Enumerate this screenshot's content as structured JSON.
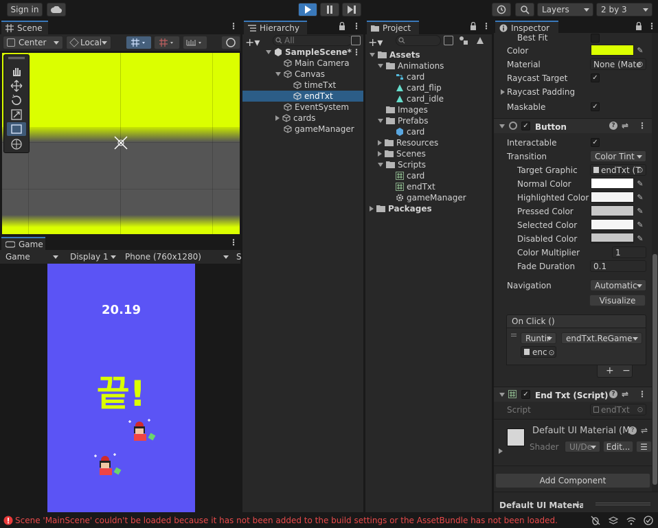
{
  "toolbar": {
    "sign_in": "Sign in",
    "layers": "Layers",
    "layout": "2 by 3"
  },
  "scene": {
    "tab": "Scene",
    "pivot": "Center",
    "space": "Local"
  },
  "game": {
    "tab": "Game",
    "mode": "Game",
    "display": "Display 1",
    "resolution": "Phone (760x1280)",
    "scale": "S",
    "timer": "20.19",
    "end_text": "끝!"
  },
  "hierarchy": {
    "tab": "Hierarchy",
    "search_placeholder": "All",
    "items": [
      "SampleScene*",
      "Main Camera",
      "Canvas",
      "timeTxt",
      "endTxt",
      "EventSystem",
      "cards",
      "gameManager"
    ]
  },
  "project": {
    "tab": "Project",
    "items": [
      "Assets",
      "Animations",
      "card",
      "card_flip",
      "card_idle",
      "Images",
      "Prefabs",
      "card",
      "Resources",
      "Scenes",
      "Scripts",
      "card",
      "endTxt",
      "gameManager",
      "Packages"
    ]
  },
  "inspector": {
    "tab": "Inspector",
    "text_rows": {
      "best_fit": "Best Fit",
      "color": "Color",
      "material": "Material",
      "material_value": "None (Mate",
      "raycast_target": "Raycast Target",
      "raycast_padding": "Raycast Padding",
      "maskable": "Maskable"
    },
    "button": {
      "title": "Button",
      "interactable": "Interactable",
      "transition": "Transition",
      "transition_value": "Color Tint",
      "target_graphic": "Target Graphic",
      "target_graphic_value": "endTxt (T",
      "normal_color": "Normal Color",
      "highlighted_color": "Highlighted Color",
      "pressed_color": "Pressed Color",
      "selected_color": "Selected Color",
      "disabled_color": "Disabled Color",
      "color_multiplier": "Color Multiplier",
      "color_multiplier_value": "1",
      "fade_duration": "Fade Duration",
      "fade_duration_value": "0.1",
      "navigation": "Navigation",
      "navigation_value": "Automatic",
      "visualize": "Visualize",
      "on_click": "On Click ()",
      "runtime": "Runtir",
      "function": "endTxt.ReGame",
      "object": "enc",
      "plus": "+",
      "minus": "−"
    },
    "script": {
      "title": "End Txt (Script)",
      "label": "Script",
      "value": "endTxt"
    },
    "material": {
      "name": "Default UI Material (M",
      "shader_label": "Shader",
      "shader_value": "UI/De",
      "edit": "Edit..."
    },
    "add_component": "Add Component",
    "preview": "Default UI Material"
  },
  "status": {
    "error": "Scene 'MainScene' couldn't be loaded because it has not been added to the build settings or the AssetBundle has not been loaded."
  },
  "colors": {
    "yellow": "#dbff00",
    "game_bg": "#5b54f5",
    "accent": "#3a79bb"
  }
}
